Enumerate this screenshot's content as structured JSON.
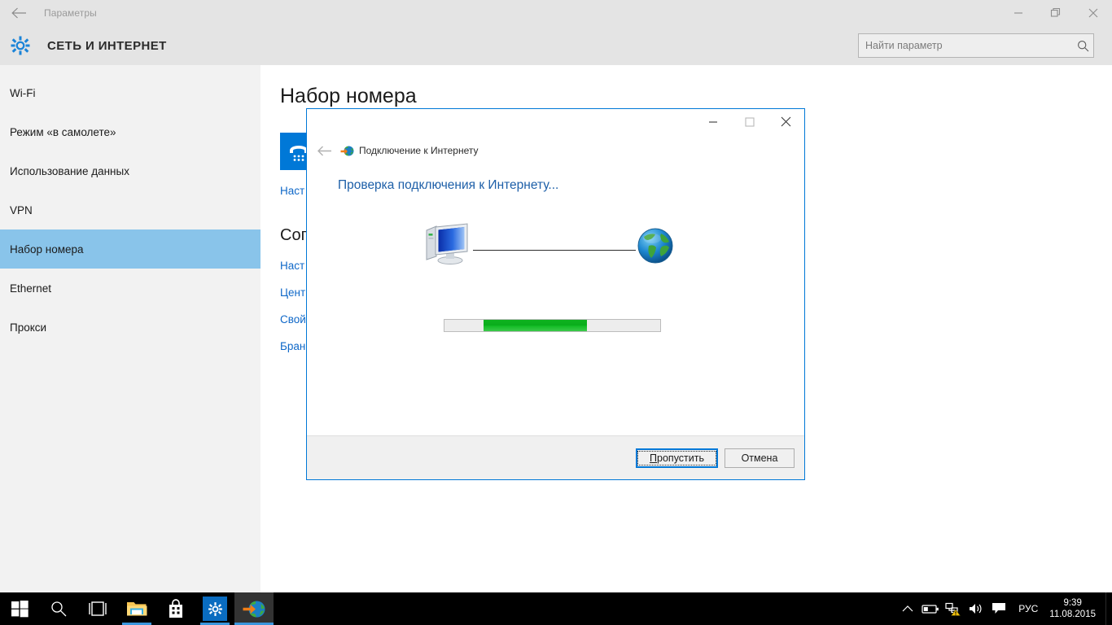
{
  "window": {
    "title": "Параметры",
    "back_icon": "back-arrow-icon",
    "minimize_icon": "minimize-icon",
    "restore_icon": "restore-icon",
    "close_icon": "close-icon"
  },
  "header": {
    "icon": "gear-icon",
    "title": "СЕТЬ И ИНТЕРНЕТ",
    "search_placeholder": "Найти параметр",
    "search_value": "",
    "search_icon": "search-icon"
  },
  "sidebar": {
    "items": [
      {
        "label": "Wi-Fi",
        "active": false
      },
      {
        "label": "Режим «в самолете»",
        "active": false
      },
      {
        "label": "Использование данных",
        "active": false
      },
      {
        "label": "VPN",
        "active": false
      },
      {
        "label": "Набор номера",
        "active": true
      },
      {
        "label": "Ethernet",
        "active": false
      },
      {
        "label": "Прокси",
        "active": false
      }
    ]
  },
  "content": {
    "page_title": "Набор номера",
    "tile_icon": "dialup-phone-icon",
    "link_1": "Наст",
    "section_title": "Соп",
    "link_2": "Наст",
    "link_3": "Цент",
    "link_4": "Свой",
    "link_5": "Бран"
  },
  "dialog": {
    "app_icon": "internet-connection-icon",
    "app_title": "Подключение к Интернету",
    "back_icon": "back-arrow-icon",
    "minimize_icon": "minimize-icon",
    "maximize_icon": "maximize-icon",
    "close_icon": "close-icon",
    "heading": "Проверка подключения к Интернету...",
    "pc_icon": "computer-icon",
    "globe_icon": "globe-icon",
    "connection_line": "connection-line",
    "progress": {
      "style": "marquee",
      "fill_color": "#0bb01f",
      "track_color": "#ededed",
      "chunk_start_pct": 18,
      "chunk_width_pct": 48
    },
    "buttons": {
      "skip": {
        "label": "Пропустить",
        "accel": "П",
        "rest": "ропустить",
        "default": true
      },
      "cancel": {
        "label": "Отмена",
        "default": false
      }
    }
  },
  "taskbar": {
    "items": [
      {
        "name": "start-button",
        "icon": "windows-logo-icon"
      },
      {
        "name": "search-button",
        "icon": "search-icon"
      },
      {
        "name": "task-view-button",
        "icon": "task-view-icon"
      },
      {
        "name": "file-explorer-button",
        "icon": "folder-icon"
      },
      {
        "name": "store-button",
        "icon": "shopping-bag-icon"
      },
      {
        "name": "settings-button",
        "icon": "gear-icon"
      },
      {
        "name": "internet-connection-button",
        "icon": "internet-connection-icon"
      }
    ],
    "tray": {
      "expand_icon": "chevron-up-icon",
      "battery_icon": "battery-icon",
      "network_icon": "network-warning-icon",
      "volume_icon": "speaker-icon",
      "action_center_icon": "notification-icon",
      "language": "РУС",
      "time": "9:39",
      "date": "11.08.2015"
    }
  },
  "colors": {
    "accent": "#0078d7",
    "sidebar_selected": "#89c4ea",
    "link": "#0f68c8",
    "heading_blue": "#1d5fa8",
    "progress_green": "#0bb01f",
    "chrome_gray": "#e4e4e4",
    "sidebar_gray": "#f2f2f2"
  }
}
